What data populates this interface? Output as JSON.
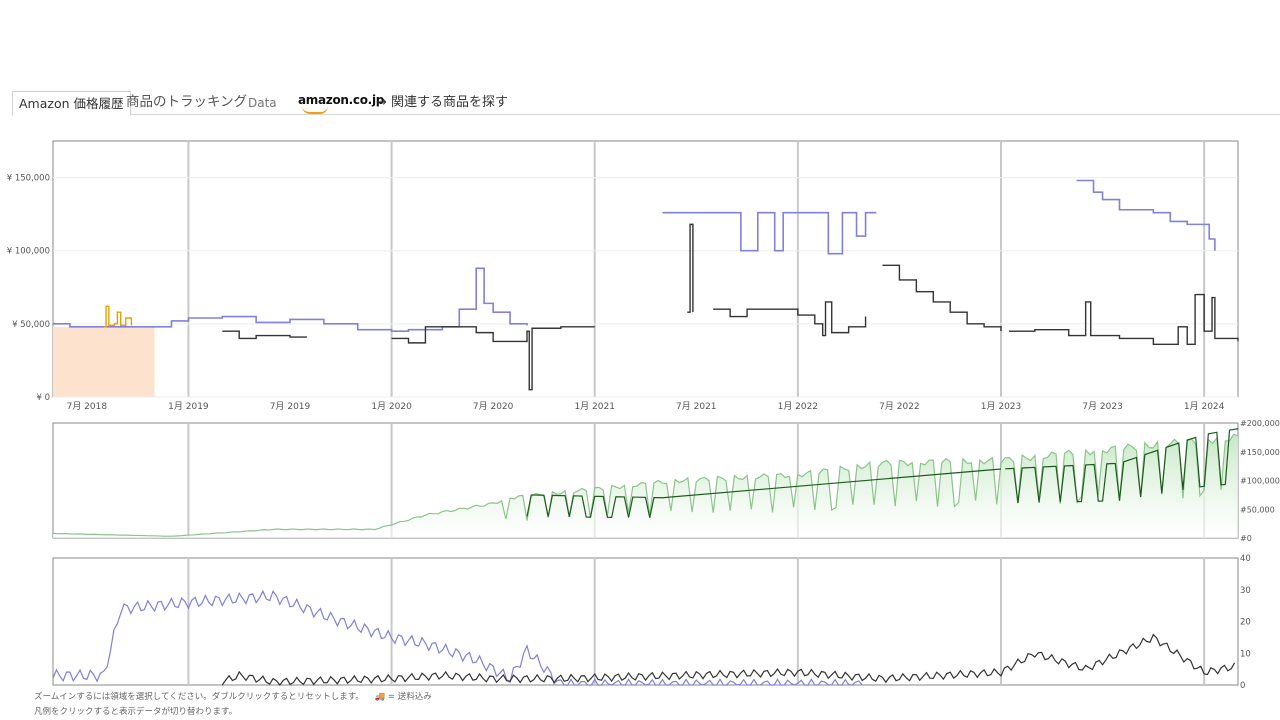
{
  "tabs": {
    "price_history": "Amazon 価格履歴",
    "tracking": "商品のトラッキング",
    "data": "Data",
    "logo": "amazon.co.jp",
    "related": "→ 関連する商品を探す"
  },
  "footnotes": {
    "zoom": "ズームインするには領域を選択してください。ダブルクリックするとリセットします。",
    "shipping_legend": "= 送料込み",
    "legend_click": "凡例をクリックすると表示データが切り替わります。"
  },
  "colors": {
    "amazon_price": "#8080dd",
    "new_price": "#333333",
    "used_price": "#e8a000",
    "amazon_oos_shade": "#fde3cd",
    "sales_rank_fill": "#c7e8c7",
    "sales_rank_line": "#8cc48c",
    "sales_rank_dark": "#1e5a1e",
    "offer_count_amazon": "#8080dd",
    "offer_count_new": "#333333"
  },
  "chart_data": [
    {
      "type": "line",
      "title": "",
      "y_tick_labels": [
        "¥ 0",
        "¥ 50,000",
        "¥ 100,000",
        "¥ 150,000"
      ],
      "ylim": [
        0,
        175000
      ],
      "x_tick_labels": [
        "7月 2018",
        "1月 2019",
        "7月 2019",
        "1月 2020",
        "7月 2020",
        "1月 2021",
        "7月 2021",
        "1月 2022",
        "7月 2022",
        "1月 2023",
        "7月 2023",
        "1月 2024"
      ],
      "x_range": [
        "2018-05",
        "2024-03"
      ],
      "grid": true,
      "series": [
        {
          "name": "",
          "color": "amazon_price",
          "segments": [
            [
              [
                "2018-05-01",
                50000
              ],
              [
                "2018-06-01",
                48000
              ],
              [
                "2018-09-01",
                48000
              ],
              [
                "2018-12-01",
                52000
              ],
              [
                "2019-01-01",
                54000
              ],
              [
                "2019-03-01",
                55000
              ],
              [
                "2019-05-01",
                51000
              ],
              [
                "2019-07-01",
                53000
              ],
              [
                "2019-09-01",
                50000
              ],
              [
                "2019-11-01",
                46000
              ],
              [
                "2020-01-01",
                45000
              ],
              [
                "2020-02-01",
                46000
              ],
              [
                "2020-04-01",
                48000
              ],
              [
                "2020-05-01",
                60000
              ],
              [
                "2020-06-01",
                88000
              ],
              [
                "2020-06-15",
                64000
              ],
              [
                "2020-07-01",
                58000
              ],
              [
                "2020-08-01",
                50000
              ],
              [
                "2020-09-01",
                49000
              ]
            ],
            [
              [
                "2021-05-01",
                126000
              ],
              [
                "2021-09-15",
                126000
              ],
              [
                "2021-09-20",
                100000
              ],
              [
                "2021-10-15",
                100000
              ],
              [
                "2021-10-20",
                126000
              ],
              [
                "2021-11-15",
                126000
              ],
              [
                "2021-11-20",
                100000
              ],
              [
                "2021-12-01",
                100000
              ],
              [
                "2021-12-05",
                126000
              ],
              [
                "2022-02-20",
                126000
              ],
              [
                "2022-02-25",
                98000
              ],
              [
                "2022-03-15",
                98000
              ],
              [
                "2022-03-20",
                126000
              ],
              [
                "2022-04-10",
                126000
              ],
              [
                "2022-04-15",
                110000
              ],
              [
                "2022-04-25",
                110000
              ],
              [
                "2022-05-01",
                126000
              ],
              [
                "2022-05-20",
                126000
              ]
            ],
            [
              [
                "2023-05-15",
                148000
              ],
              [
                "2023-06-15",
                140000
              ],
              [
                "2023-07-01",
                135000
              ],
              [
                "2023-08-01",
                128000
              ],
              [
                "2023-10-01",
                126000
              ],
              [
                "2023-11-01",
                120000
              ],
              [
                "2023-12-01",
                118000
              ],
              [
                "2024-01-10",
                108000
              ],
              [
                "2024-01-20",
                100000
              ]
            ]
          ]
        },
        {
          "name": "",
          "color": "new_price",
          "segments": [
            [
              [
                "2019-03-01",
                45000
              ],
              [
                "2019-04-01",
                40000
              ],
              [
                "2019-05-01",
                42000
              ],
              [
                "2019-07-01",
                41000
              ],
              [
                "2019-08-01",
                41000
              ]
            ],
            [
              [
                "2020-01-01",
                40000
              ],
              [
                "2020-02-01",
                37000
              ],
              [
                "2020-03-01",
                48000
              ],
              [
                "2020-05-01",
                48000
              ],
              [
                "2020-06-01",
                44000
              ],
              [
                "2020-07-01",
                38000
              ],
              [
                "2020-08-01",
                38000
              ],
              [
                "2020-09-01",
                45000
              ],
              [
                "2020-09-05",
                5000
              ],
              [
                "2020-09-10",
                47000
              ],
              [
                "2020-11-01",
                48000
              ],
              [
                "2021-01-01",
                48000
              ]
            ],
            [
              [
                "2021-06-15",
                58000
              ],
              [
                "2021-06-20",
                118000
              ],
              [
                "2021-06-25",
                58000
              ]
            ],
            [
              [
                "2021-08-01",
                60000
              ],
              [
                "2021-09-01",
                55000
              ],
              [
                "2021-10-01",
                60000
              ],
              [
                "2021-12-01",
                60000
              ],
              [
                "2022-01-01",
                56000
              ],
              [
                "2022-02-01",
                50000
              ],
              [
                "2022-02-15",
                42000
              ],
              [
                "2022-02-20",
                65000
              ],
              [
                "2022-03-01",
                44000
              ],
              [
                "2022-04-01",
                48000
              ],
              [
                "2022-05-01",
                55000
              ]
            ],
            [
              [
                "2022-06-01",
                90000
              ],
              [
                "2022-07-01",
                80000
              ],
              [
                "2022-08-01",
                72000
              ],
              [
                "2022-09-01",
                65000
              ],
              [
                "2022-10-01",
                58000
              ],
              [
                "2022-11-01",
                50000
              ],
              [
                "2022-12-01",
                48000
              ],
              [
                "2023-01-01",
                45000
              ]
            ],
            [
              [
                "2023-01-15",
                45000
              ],
              [
                "2023-03-01",
                46000
              ],
              [
                "2023-05-01",
                42000
              ],
              [
                "2023-06-01",
                65000
              ],
              [
                "2023-06-10",
                42000
              ],
              [
                "2023-08-01",
                40000
              ],
              [
                "2023-10-01",
                36000
              ],
              [
                "2023-11-15",
                48000
              ],
              [
                "2023-12-01",
                36000
              ],
              [
                "2023-12-15",
                70000
              ],
              [
                "2024-01-01",
                45000
              ],
              [
                "2024-01-15",
                68000
              ],
              [
                "2024-01-20",
                40000
              ],
              [
                "2024-03-01",
                38000
              ]
            ]
          ]
        },
        {
          "name": "",
          "color": "used_price",
          "segments": [
            [
              [
                "2018-08-01",
                48000
              ],
              [
                "2018-08-05",
                62000
              ],
              [
                "2018-08-10",
                49000
              ],
              [
                "2018-08-20",
                50000
              ],
              [
                "2018-08-25",
                58000
              ],
              [
                "2018-09-01",
                49000
              ],
              [
                "2018-09-10",
                54000
              ],
              [
                "2018-09-20",
                49000
              ]
            ]
          ]
        }
      ],
      "shaded_range": [
        "2018-05-01",
        "2018-11-01"
      ]
    },
    {
      "type": "area",
      "title": "",
      "y_tick_labels": [
        "#0",
        "#50,000",
        "#100,000",
        "#150,000",
        "#200,000"
      ],
      "ylim": [
        0,
        200000
      ],
      "x_range": [
        "2018-05",
        "2024-03"
      ],
      "series": [
        {
          "name": "",
          "color": "sales_rank_line",
          "points": [
            [
              "2018-05",
              8000
            ],
            [
              "2018-12",
              3000
            ],
            [
              "2019-06",
              15000
            ],
            [
              "2019-12",
              15000
            ],
            [
              "2020-03",
              40000
            ],
            [
              "2020-07",
              60000
            ],
            [
              "2020-08",
              70000
            ],
            [
              "2021-01",
              85000
            ],
            [
              "2021-06",
              100000
            ],
            [
              "2022-01",
              110000
            ],
            [
              "2022-06",
              130000
            ],
            [
              "2023-01",
              135000
            ],
            [
              "2023-06",
              150000
            ],
            [
              "2024-01",
              170000
            ],
            [
              "2024-03",
              175000
            ]
          ]
        },
        {
          "name": "",
          "color": "sales_rank_dark",
          "points": [
            [
              "2020-09",
              75000
            ],
            [
              "2021-05",
              70000
            ],
            [
              "2023-01",
              120000
            ],
            [
              "2023-08",
              130000
            ],
            [
              "2024-01",
              180000
            ],
            [
              "2024-03",
              190000
            ]
          ]
        }
      ]
    },
    {
      "type": "line",
      "title": "",
      "y_tick_labels": [
        "0",
        "10",
        "20",
        "30",
        "40"
      ],
      "ylim": [
        0,
        40
      ],
      "x_range": [
        "2018-05",
        "2024-03"
      ],
      "series": [
        {
          "name": "",
          "color": "offer_count_amazon",
          "points": [
            [
              "2018-05",
              3
            ],
            [
              "2018-08",
              3
            ],
            [
              "2018-09",
              24
            ],
            [
              "2019-01",
              26
            ],
            [
              "2019-06",
              28
            ],
            [
              "2019-10",
              20
            ],
            [
              "2020-01",
              15
            ],
            [
              "2020-03",
              13
            ],
            [
              "2020-06",
              8
            ],
            [
              "2020-08",
              2
            ],
            [
              "2020-09",
              11
            ],
            [
              "2020-11",
              0
            ],
            [
              "2021-06",
              0
            ],
            [
              "2022-05",
              0
            ]
          ]
        },
        {
          "name": "",
          "color": "offer_count_new",
          "points": [
            [
              "2019-03",
              1
            ],
            [
              "2019-04",
              3
            ],
            [
              "2019-06",
              1
            ],
            [
              "2020-01",
              2
            ],
            [
              "2020-04",
              3
            ],
            [
              "2020-07",
              2
            ],
            [
              "2020-11",
              2
            ],
            [
              "2022-01",
              4
            ],
            [
              "2022-06",
              2
            ],
            [
              "2023-01",
              4
            ],
            [
              "2023-03",
              10
            ],
            [
              "2023-06",
              5
            ],
            [
              "2023-10",
              15
            ],
            [
              "2024-01",
              4
            ],
            [
              "2024-03",
              6
            ]
          ]
        }
      ]
    }
  ]
}
